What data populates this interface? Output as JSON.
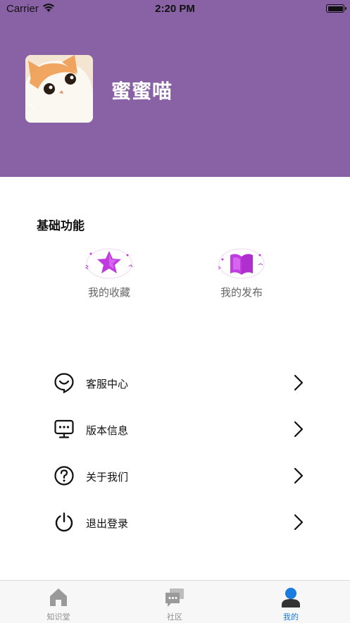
{
  "status_bar": {
    "carrier": "Carrier",
    "time": "2:20 PM"
  },
  "profile": {
    "username": "蜜蜜喵"
  },
  "basic_functions": {
    "title": "基础功能",
    "items": [
      {
        "label": "我的收藏",
        "icon": "star-icon"
      },
      {
        "label": "我的发布",
        "icon": "book-icon"
      }
    ]
  },
  "menu": [
    {
      "label": "客服中心",
      "icon": "customer-service-icon"
    },
    {
      "label": "版本信息",
      "icon": "version-info-icon"
    },
    {
      "label": "关于我们",
      "icon": "question-icon"
    },
    {
      "label": "退出登录",
      "icon": "power-icon"
    }
  ],
  "tabbar": {
    "tabs": [
      {
        "label": "知识堂",
        "icon": "home-icon"
      },
      {
        "label": "社区",
        "icon": "chat-icon"
      },
      {
        "label": "我的",
        "icon": "user-icon",
        "active": true
      }
    ]
  },
  "colors": {
    "header_bg": "#8862a4",
    "accent": "#1a7be0",
    "icon_magenta": "#c03ce0"
  }
}
